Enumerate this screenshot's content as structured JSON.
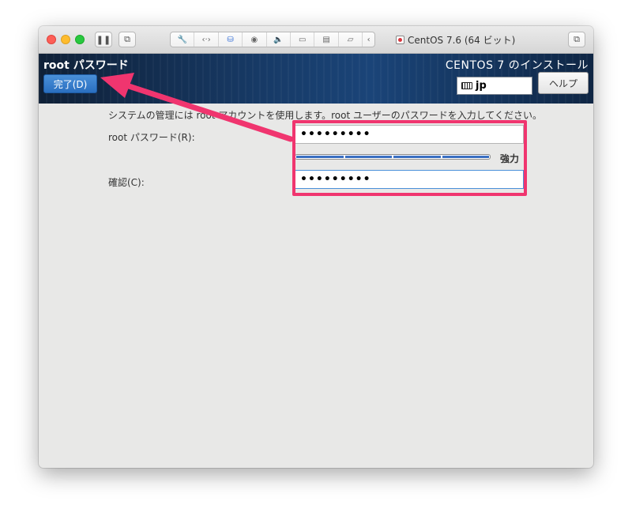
{
  "window": {
    "title": "CentOS 7.6 (64 ビット)"
  },
  "header": {
    "spoke_title": "root パスワード",
    "done_button": "完了(D)",
    "install_title": "CENTOS 7 のインストール",
    "keyboard_layout": "jp",
    "help_button": "ヘルプ"
  },
  "form": {
    "instruction": "システムの管理には root アカウントを使用します。root ユーザーのパスワードを入力してください。",
    "password_label": "root パスワード(R):",
    "password_value": "•••••••••",
    "strength_level": 1.0,
    "strength_label": "強力",
    "confirm_label": "確認(C):",
    "confirm_value": "•••••••••"
  },
  "colors": {
    "annotation": "#f0356f",
    "accent": "#2a6fc0"
  },
  "icons": {
    "pause": "pause-icon",
    "snapshot": "snapshot-icon",
    "wrench": "wrench-icon",
    "code": "code-icon",
    "disk": "disk-icon",
    "camera": "camera-icon",
    "sound": "sound-icon",
    "video": "video-icon",
    "printer": "printer-icon",
    "folder": "folder-icon",
    "back": "chevron-left-icon",
    "fullscreen": "fullscreen-icon"
  }
}
